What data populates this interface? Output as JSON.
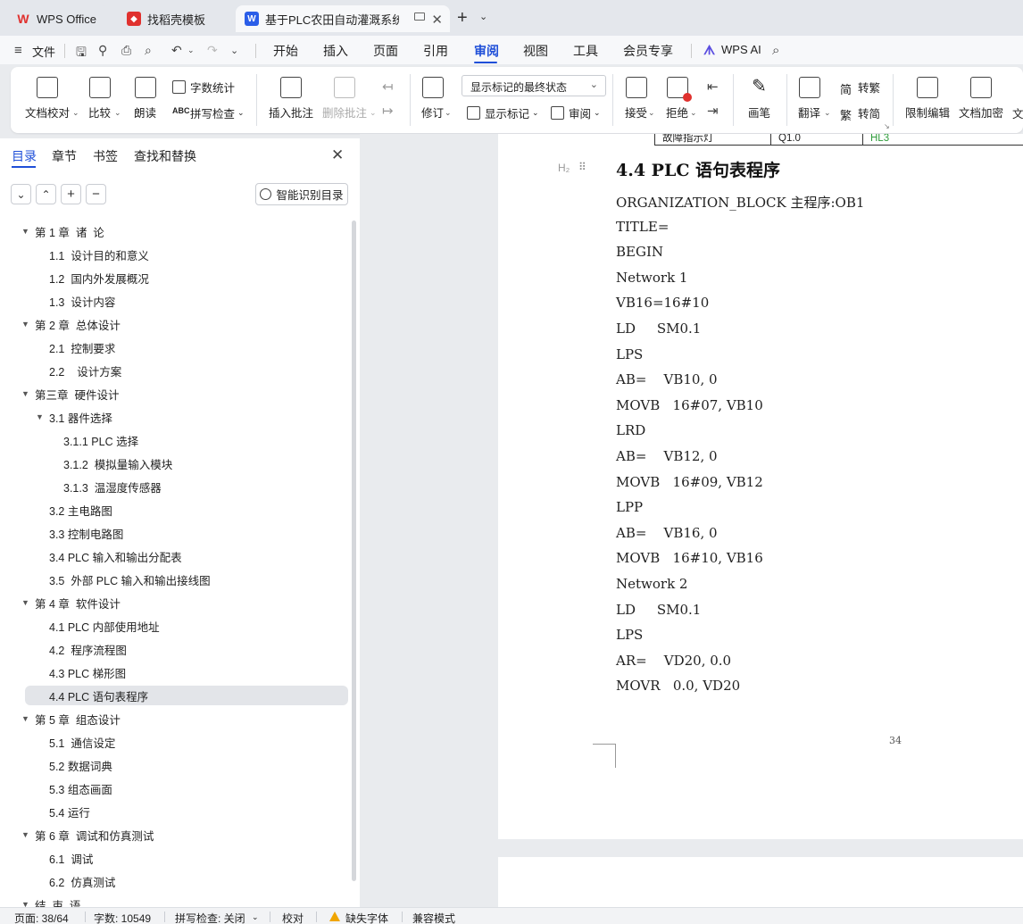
{
  "tabs": [
    {
      "label": "WPS Office",
      "icon": "wps-logo-icon"
    },
    {
      "label": "找稻壳模板",
      "icon": "docer-icon"
    },
    {
      "label": "基于PLC农田自动灌溉系统仿真",
      "icon": "word-doc-icon"
    }
  ],
  "colors": {
    "accent": "#1f4fd8",
    "wps_red": "#e0312e",
    "doc_blue": "#2b5ee8",
    "warning": "#f0a500",
    "green_text": "#2e9c3a"
  },
  "menubar": {
    "file": "文件",
    "items": [
      "开始",
      "插入",
      "页面",
      "引用",
      "审阅",
      "视图",
      "工具",
      "会员专享"
    ],
    "active": "审阅",
    "wps_ai": "WPS AI"
  },
  "ribbon": {
    "doc_proofread": "文档校对",
    "compare": "比较",
    "read_aloud": "朗读",
    "word_count": "字数统计",
    "spell_check": "拼写检查",
    "insert_comment": "插入批注",
    "delete_comment": "删除批注",
    "revision": "修订",
    "markup_state": "显示标记的最终状态",
    "show_markup": "显示标记",
    "review": "审阅",
    "accept": "接受",
    "reject": "拒绝",
    "pen": "画笔",
    "translate": "翻译",
    "to_traditional": "转繁",
    "to_simplified": "转简",
    "restrict_edit": "限制编辑",
    "doc_encrypt": "文档加密",
    "more": "文"
  },
  "nav": {
    "tabs": [
      "目录",
      "章节",
      "书签",
      "查找和替换"
    ],
    "smart_toc": "智能识别目录",
    "toc": [
      {
        "label": "第 1 章  诸  论",
        "level": 1,
        "expanded": true
      },
      {
        "label": "1.1  设计目的和意义",
        "level": 2
      },
      {
        "label": "1.2  国内外发展概况",
        "level": 2
      },
      {
        "label": "1.3  设计内容",
        "level": 2
      },
      {
        "label": "第 2 章  总体设计",
        "level": 1,
        "expanded": true
      },
      {
        "label": "2.1  控制要求",
        "level": 2
      },
      {
        "label": "2.2    设计方案",
        "level": 2
      },
      {
        "label": "第三章  硬件设计",
        "level": 1,
        "expanded": true
      },
      {
        "label": "3.1 器件选择",
        "level": 2,
        "expanded": true
      },
      {
        "label": "3.1.1 PLC 选择",
        "level": 3
      },
      {
        "label": "3.1.2  模拟量输入模块",
        "level": 3
      },
      {
        "label": "3.1.3  温湿度传感器",
        "level": 3
      },
      {
        "label": "3.2 主电路图",
        "level": 2
      },
      {
        "label": "3.3 控制电路图",
        "level": 2
      },
      {
        "label": "3.4 PLC 输入和输出分配表",
        "level": 2
      },
      {
        "label": "3.5  外部 PLC 输入和输出接线图",
        "level": 2
      },
      {
        "label": "第 4 章  软件设计",
        "level": 1,
        "expanded": true
      },
      {
        "label": "4.1 PLC 内部使用地址",
        "level": 2
      },
      {
        "label": "4.2  程序流程图",
        "level": 2
      },
      {
        "label": "4.3 PLC 梯形图",
        "level": 2
      },
      {
        "label": "4.4 PLC 语句表程序",
        "level": 2,
        "selected": true
      },
      {
        "label": "第 5 章  组态设计",
        "level": 1,
        "expanded": true
      },
      {
        "label": "5.1  通信设定",
        "level": 2
      },
      {
        "label": "5.2 数据词典",
        "level": 2
      },
      {
        "label": "5.3 组态画面",
        "level": 2
      },
      {
        "label": "5.4 运行",
        "level": 2
      },
      {
        "label": "第 6 章  调试和仿真测试",
        "level": 1,
        "expanded": true
      },
      {
        "label": "6.1  调试",
        "level": 2
      },
      {
        "label": "6.2  仿真测试",
        "level": 2
      },
      {
        "label": "结  束  语",
        "level": 1,
        "expanded": true
      }
    ]
  },
  "document": {
    "table_row": [
      "故障指示灯",
      "Q1.0",
      "HL3"
    ],
    "heading_marker": "H₂",
    "heading": "4.4 PLC 语句表程序",
    "code": [
      "ORGANIZATION_BLOCK 主程序:OB1",
      "TITLE=",
      "BEGIN",
      "Network 1",
      "VB16=16#10",
      "LD     SM0.1",
      "LPS",
      "AB=    VB10, 0",
      "MOVB   16#07, VB10",
      "LRD",
      "AB=    VB12, 0",
      "MOVB   16#09, VB12",
      "LPP",
      "AB=    VB16, 0",
      "MOVB   16#10, VB16",
      "Network 2",
      "LD     SM0.1",
      "LPS",
      "AR=    VD20, 0.0",
      "MOVR   0.0, VD20"
    ],
    "page_number": "34"
  },
  "status": {
    "page": "页面: 38/64",
    "words": "字数: 10549",
    "spell": "拼写检查: 关闭",
    "proof": "校对",
    "missing_font": "缺失字体",
    "compat": "兼容模式"
  }
}
